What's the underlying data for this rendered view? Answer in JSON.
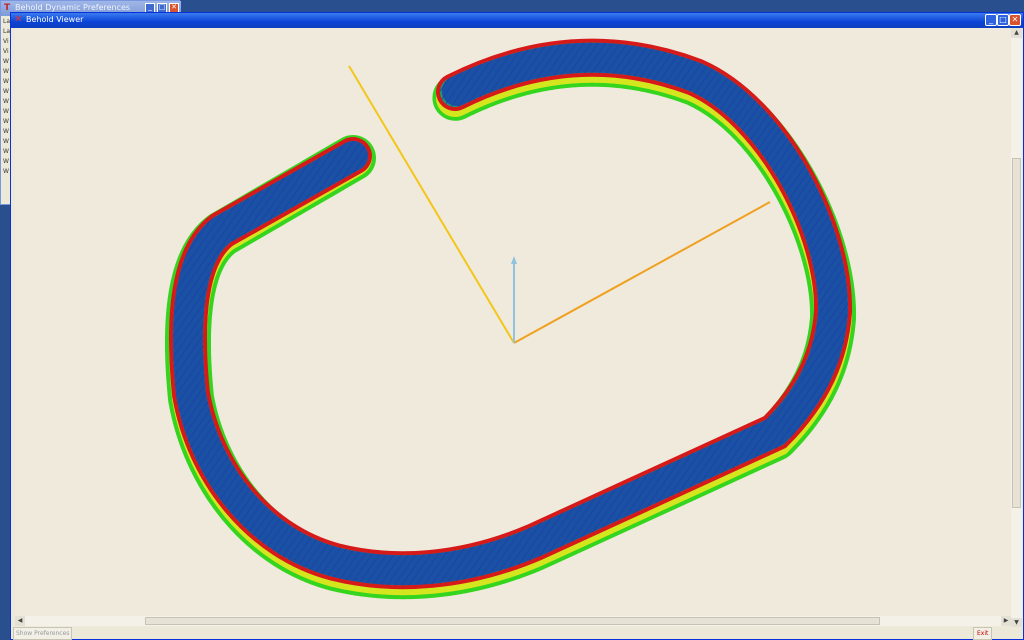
{
  "background_window": {
    "title": "Behold Dynamic Preferences",
    "list_items": [
      "La",
      "La",
      "Vi",
      "Vi",
      "W",
      "W",
      "W",
      "W",
      "W",
      "W",
      "W",
      "W",
      "W",
      "W",
      "W",
      "W"
    ]
  },
  "main_window": {
    "title": "Behold Viewer",
    "minimize_label": "_",
    "maximize_label": "□",
    "close_label": "✕"
  },
  "bottom_bar": {
    "show_preferences_label": "Show Preferences",
    "exit_label": "Exit"
  },
  "scrollbars": {
    "up_arrow": "▲",
    "down_arrow": "▼",
    "left_arrow": "◀",
    "right_arrow": "▶"
  },
  "colors": {
    "titlebar": "#0a43d6",
    "track_outline": "#d61a1a",
    "track_fill": "#1f9a6e",
    "track_cells": "#1a3fb0",
    "track_side": "#35d41e",
    "axis_x": "#f0a020",
    "axis_y": "#f3c61a",
    "axis_z": "#8fc3e0"
  }
}
